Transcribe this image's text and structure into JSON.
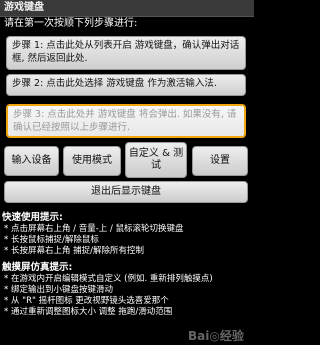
{
  "header": {
    "title": "游戏键盘"
  },
  "intro": {
    "prompt": "请在第一次按顺下列步骤进行:"
  },
  "steps": [
    {
      "text": "步骤 1: 点击此处从列表开启 游戏键盘，确认弹出对话框, 然后返回此处."
    },
    {
      "text": "步骤 2: 点击此处选择 游戏键盘 作为激活输入法."
    },
    {
      "text": "步骤 3: 点击此处并 游戏键盘 将会弹出. 如果没有, 请确认已经按照以上步骤进行."
    }
  ],
  "buttons": {
    "input_device": "输入设备",
    "usage_mode": "使用模式",
    "custom_and_test": "自定义 & 测试",
    "settings": "设置",
    "exit_keyboard": "退出后显示键盘"
  },
  "quick_tips": {
    "title": "快速使用提示:",
    "items": [
      "* 点击屏幕右上角 / 音量-上 / 鼠标滚轮切换键盘",
      "* 长按鼠标捕捉/解除鼠标",
      "* 长按屏幕右上角 捕捉/解除所有控制"
    ]
  },
  "touch_tips": {
    "title": "触摸屏仿真提示:",
    "items": [
      "* 在游戏内开启编辑模式自定义 (例如. 重新排列触摸点)",
      "* 绑定输出到小键盘按键滑动",
      "* 从 \"R\" 摇杆图标 更改视野镜头选喜爱那个",
      "* 通过重新调整图标大小 调整 拖跑/滑动范围"
    ]
  },
  "watermark": {
    "text": "Bai◎经验"
  },
  "colors": {
    "background": "#000000",
    "step_highlight_border": "#f2a60d",
    "button_face": "#dddddd"
  }
}
